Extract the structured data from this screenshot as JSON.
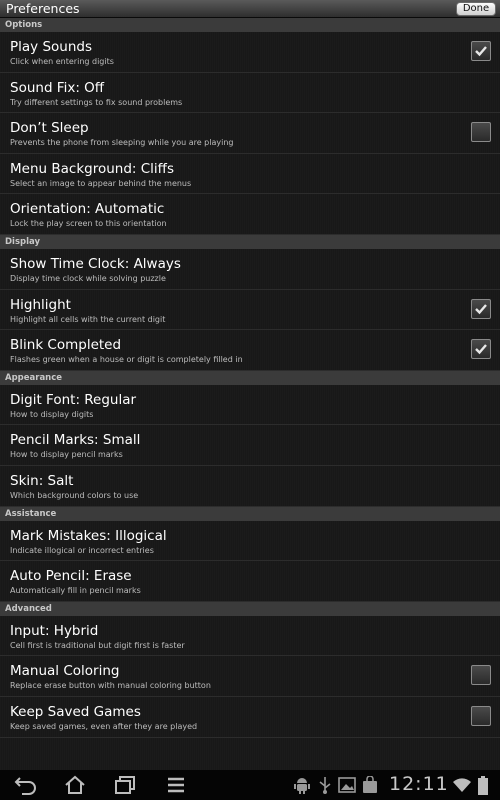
{
  "titlebar": {
    "title": "Preferences",
    "done_label": "Done"
  },
  "sections": [
    {
      "header": "Options",
      "rows": [
        {
          "title": "Play Sounds",
          "subtitle": "Click when entering digits",
          "checkbox": true,
          "checked": true
        },
        {
          "title": "Sound Fix: Off",
          "subtitle": "Try different settings to fix sound problems",
          "checkbox": false
        },
        {
          "title": "Don’t Sleep",
          "subtitle": "Prevents the phone from sleeping while you are playing",
          "checkbox": true,
          "checked": false
        },
        {
          "title": "Menu Background: Cliffs",
          "subtitle": "Select an image to appear behind the menus",
          "checkbox": false
        },
        {
          "title": "Orientation: Automatic",
          "subtitle": "Lock the play screen to this orientation",
          "checkbox": false
        }
      ]
    },
    {
      "header": "Display",
      "rows": [
        {
          "title": "Show Time Clock: Always",
          "subtitle": "Display time clock while solving puzzle",
          "checkbox": false
        },
        {
          "title": "Highlight",
          "subtitle": "Highlight all cells with the current digit",
          "checkbox": true,
          "checked": true
        },
        {
          "title": "Blink Completed",
          "subtitle": "Flashes green when a house or digit is completely filled in",
          "checkbox": true,
          "checked": true
        }
      ]
    },
    {
      "header": "Appearance",
      "rows": [
        {
          "title": "Digit Font: Regular",
          "subtitle": "How to display digits",
          "checkbox": false
        },
        {
          "title": "Pencil Marks: Small",
          "subtitle": "How to display pencil marks",
          "checkbox": false
        },
        {
          "title": "Skin: Salt",
          "subtitle": "Which background colors to use",
          "checkbox": false
        }
      ]
    },
    {
      "header": "Assistance",
      "rows": [
        {
          "title": "Mark Mistakes: Illogical",
          "subtitle": "Indicate illogical or incorrect entries",
          "checkbox": false
        },
        {
          "title": "Auto Pencil: Erase",
          "subtitle": "Automatically fill in pencil marks",
          "checkbox": false
        }
      ]
    },
    {
      "header": "Advanced",
      "rows": [
        {
          "title": "Input: Hybrid",
          "subtitle": "Cell first is traditional but digit first is faster",
          "checkbox": false
        },
        {
          "title": "Manual Coloring",
          "subtitle": "Replace erase button with manual coloring button",
          "checkbox": true,
          "checked": false
        },
        {
          "title": "Keep Saved Games",
          "subtitle": "Keep saved games, even after they are played",
          "checkbox": true,
          "checked": false
        }
      ]
    }
  ],
  "navbar": {
    "buttons": [
      "back-icon",
      "home-icon",
      "recent-apps-icon",
      "menu-icon"
    ],
    "status_icons": [
      "android-debug-icon",
      "usb-icon",
      "gallery-icon",
      "shopping-bag-icon"
    ],
    "clock": "12:11",
    "wifi_icon": "wifi-icon",
    "battery_icon": "battery-icon"
  },
  "colors": {
    "background": "#141414",
    "section_header": "#3b3b3b",
    "accent_check": "#e8e8e8"
  }
}
